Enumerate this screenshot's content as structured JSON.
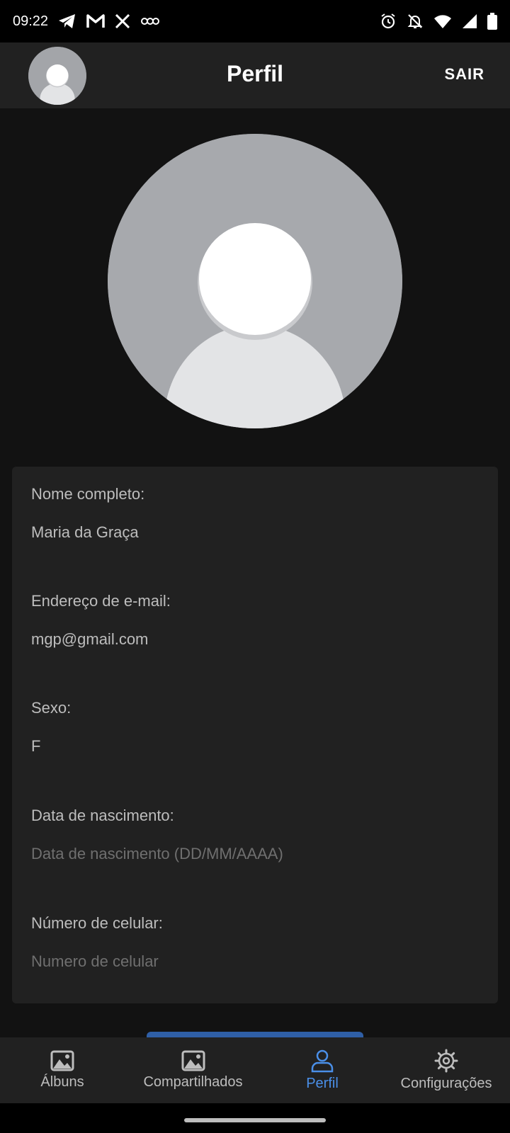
{
  "status_bar": {
    "time": "09:22",
    "left_icons": [
      "telegram-icon",
      "gmail-icon",
      "x-icon",
      "voicemail-icon"
    ],
    "right_icons": [
      "alarm-icon",
      "notifications-off-icon",
      "wifi-icon",
      "signal-icon",
      "battery-icon"
    ]
  },
  "app_bar": {
    "title": "Perfil",
    "logout_label": "SAIR"
  },
  "profile": {
    "fields": [
      {
        "label": "Nome completo:",
        "value": "Maria da Graça",
        "placeholder": ""
      },
      {
        "label": "Endereço de e-mail:",
        "value": "mgp@gmail.com",
        "placeholder": ""
      },
      {
        "label": "Sexo:",
        "value": "F",
        "placeholder": ""
      },
      {
        "label": "Data de nascimento:",
        "value": "",
        "placeholder": "Data de nascimento (DD/MM/AAAA)"
      },
      {
        "label": "Número de celular:",
        "value": "",
        "placeholder": "Numero de celular"
      }
    ]
  },
  "bottom_nav": {
    "items": [
      {
        "label": "Álbuns",
        "icon": "image-icon",
        "active": false
      },
      {
        "label": "Compartilhados",
        "icon": "image-icon",
        "active": false
      },
      {
        "label": "Perfil",
        "icon": "person-icon",
        "active": true
      },
      {
        "label": "Configurações",
        "icon": "gear-icon",
        "active": false
      }
    ]
  },
  "colors": {
    "accent": "#4a8fe8",
    "background": "#121212",
    "surface": "#212121",
    "button": "#2f5fa6"
  }
}
